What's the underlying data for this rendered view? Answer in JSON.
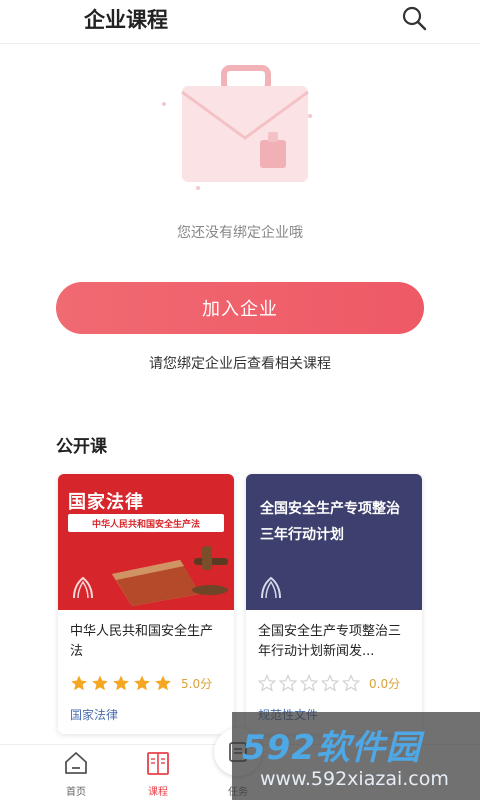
{
  "header": {
    "title": "企业课程",
    "search_icon": "search-icon"
  },
  "empty_state": {
    "message": "您还没有绑定企业哦",
    "illustration": "briefcase-icon"
  },
  "join_button": {
    "label": "加入企业"
  },
  "hint": "请您绑定企业后查看相关课程",
  "public_section": {
    "title": "公开课"
  },
  "courses": [
    {
      "thumb_title": "国家法律",
      "thumb_band": "中华人民共和国安全生产法",
      "name": "中华人民共和国安全生产法",
      "rating": 5,
      "score": "5.0分",
      "tag": "国家法律"
    },
    {
      "thumb_line1": "全国安全生产专项整治",
      "thumb_line2": "三年行动计划",
      "name": "全国安全生产专项整治三年行动计划新闻发...",
      "rating": 0,
      "score": "0.0分",
      "tag": "规范性文件"
    }
  ],
  "tabbar": {
    "items": [
      {
        "label": "首页",
        "icon": "home-icon",
        "active": false
      },
      {
        "label": "课程",
        "icon": "book-icon",
        "active": true
      },
      {
        "label": "任务",
        "icon": "task-icon",
        "active": false
      }
    ]
  },
  "watermark": {
    "big": "592软件园",
    "small": "www.592xiazai.com"
  },
  "colors": {
    "accent": "#ee5966",
    "star": "#f5a623",
    "tag": "#4a6fb0"
  }
}
